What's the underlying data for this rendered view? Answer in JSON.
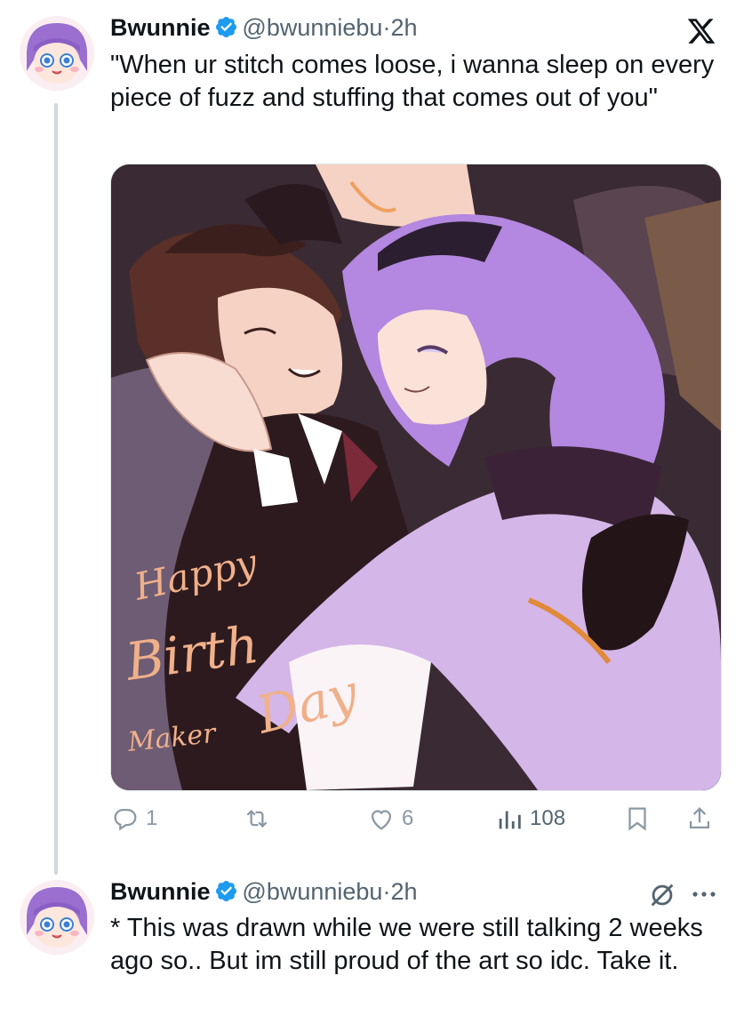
{
  "tweet1": {
    "display_name": "Bwunnie",
    "handle": "@bwunniebu",
    "separator": "·",
    "time": "2h",
    "text": "\"When ur stitch comes loose, i wanna sleep on every piece of fuzz and stuffing that comes out of you\"",
    "media": {
      "caption_line1": "Happy",
      "caption_line2": "Birth",
      "caption_line3": "Day",
      "caption_line4": "Maker"
    },
    "actions": {
      "reply_count": "1",
      "retweet_count": "",
      "like_count": "6",
      "views_count": "108"
    }
  },
  "tweet2": {
    "display_name": "Bwunnie",
    "handle": "@bwunniebu",
    "separator": "·",
    "time": "2h",
    "text": "* This was drawn while we were still talking 2 weeks ago so.. But im still proud of the art so idc. Take it."
  },
  "top_right_icon": "x-logo-icon",
  "colors": {
    "verified_blue": "#1d9bf0",
    "text": "#0f1419",
    "muted": "#536471",
    "thread_line": "#cfd9de"
  }
}
